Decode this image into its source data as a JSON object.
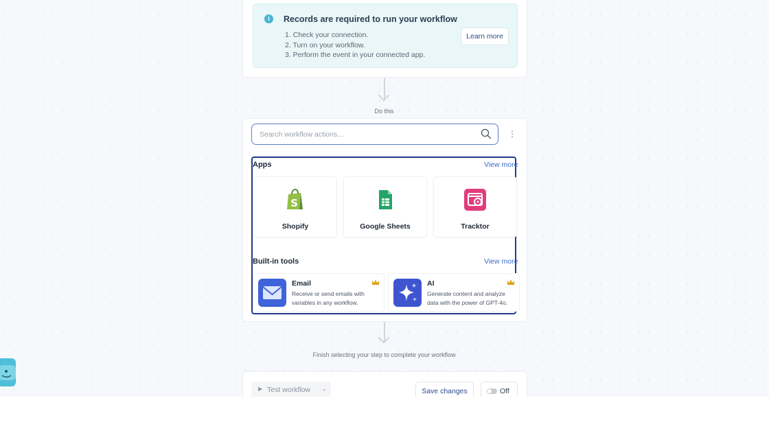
{
  "trigger": {
    "info_title": "Records are required to run your workflow",
    "steps": [
      "1. Check your connection.",
      "2. Turn on your workflow.",
      "3. Perform the event in your connected app."
    ],
    "learn_more": "Learn more"
  },
  "connector_label_1": "Do this",
  "action": {
    "search_placeholder": "Search workflow actions...",
    "apps_title": "Apps",
    "apps_view_more": "View more",
    "apps": [
      {
        "name": "Shopify",
        "icon": "shopify-icon",
        "color": "#95bf47"
      },
      {
        "name": "Google Sheets",
        "icon": "google-sheets-icon",
        "color": "#23a566"
      },
      {
        "name": "Tracktor",
        "icon": "tracktor-icon",
        "color": "#e03c7e"
      }
    ],
    "tools_title": "Built-in tools",
    "tools_view_more": "View more",
    "tools": [
      {
        "name": "Email",
        "description": "Receive or send emails with variables in any workflow.",
        "icon": "email-icon",
        "color": "#3f63d8"
      },
      {
        "name": "AI",
        "description": "Generate content and analyze data with the power of GPT-4o.",
        "icon": "sparkle-icon",
        "color": "#3f55d0"
      }
    ]
  },
  "connector_label_2": "Finish selecting your step to complete your workflow",
  "footer": {
    "test_label": "Test workflow",
    "save_label": "Save changes",
    "toggle_label": "Off"
  },
  "colors": {
    "accent": "#3b6bc4",
    "selection_border": "#1f3b8a",
    "premium_crown": "#e0a21a"
  }
}
